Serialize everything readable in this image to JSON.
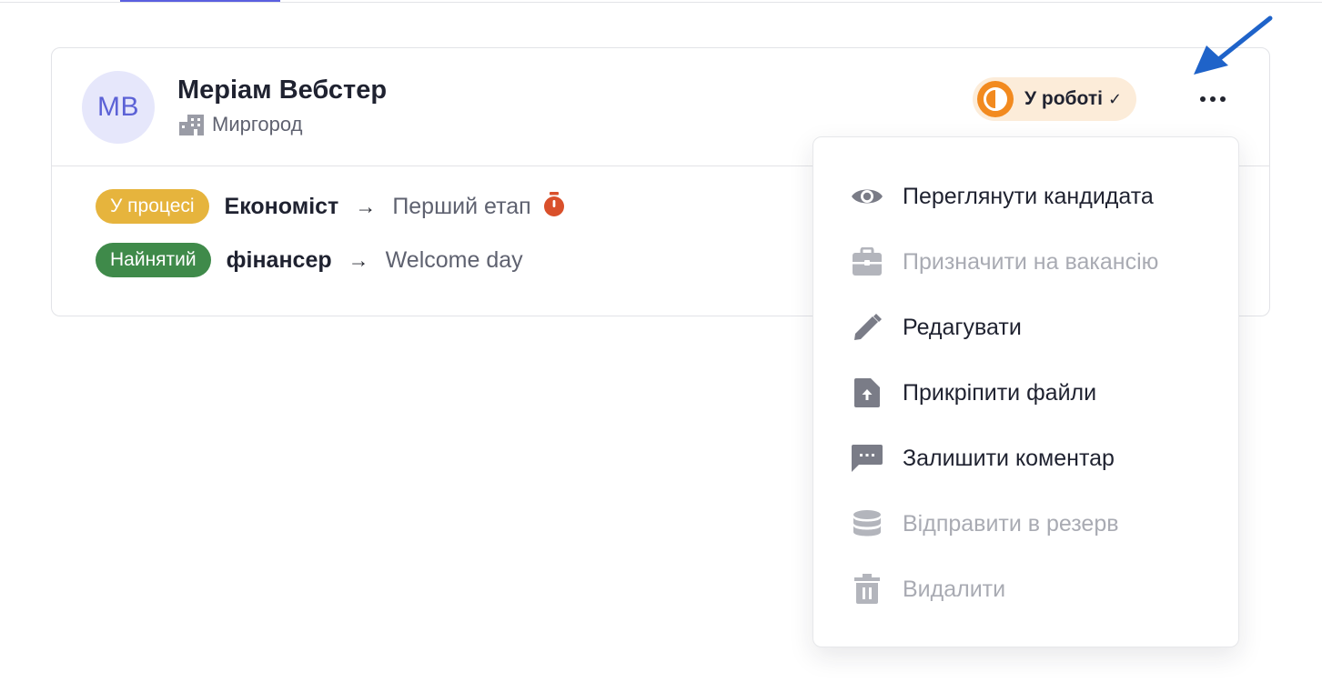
{
  "candidate": {
    "initials": "MB",
    "name": "Меріам Вебстер",
    "location": "Миргород"
  },
  "status": {
    "label": "У роботі",
    "check": "✓"
  },
  "applications": [
    {
      "badge": "У процесі",
      "position": "Економіст",
      "arrow": "→",
      "stage": "Перший етап"
    },
    {
      "badge": "Найнятий",
      "position": "фінансер",
      "arrow": "→",
      "stage": "Welcome day"
    }
  ],
  "menu": {
    "items": [
      {
        "label": "Переглянути кандидата",
        "icon": "eye-icon",
        "disabled": false
      },
      {
        "label": "Призначити на вакансію",
        "icon": "briefcase-icon",
        "disabled": true
      },
      {
        "label": "Редагувати",
        "icon": "pencil-icon",
        "disabled": false
      },
      {
        "label": "Прикріпити файли",
        "icon": "file-upload-icon",
        "disabled": false
      },
      {
        "label": "Залишити коментар",
        "icon": "comment-icon",
        "disabled": false
      },
      {
        "label": "Відправити в резерв",
        "icon": "database-icon",
        "disabled": true
      },
      {
        "label": "Видалити",
        "icon": "trash-icon",
        "disabled": true
      }
    ]
  },
  "colors": {
    "avatar_bg": "#e6e7fb",
    "avatar_text": "#5c62d6",
    "status_bg": "#fcecd9",
    "status_ring": "#f28a1f",
    "in_progress_badge": "#e6b43d",
    "hired_badge": "#3f8a4a",
    "timer": "#d9502b",
    "annotation_arrow": "#1f63c9"
  }
}
